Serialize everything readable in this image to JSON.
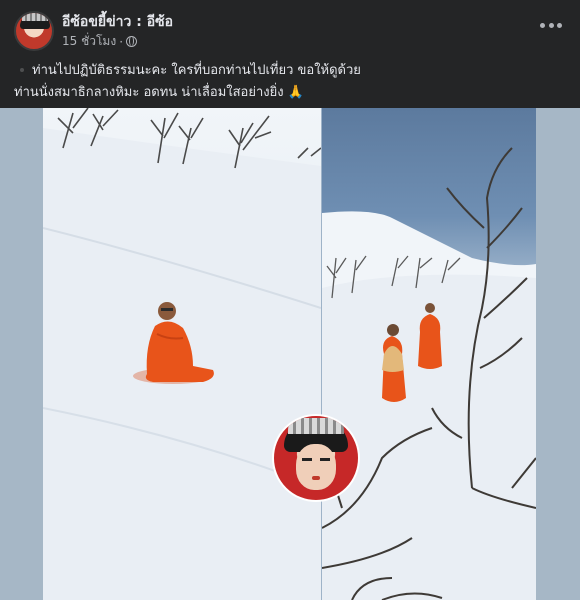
{
  "post": {
    "page_name": "อีซ้อขยี้ข่าว : อีซ้อ",
    "timestamp": "15 ชั่วโมง",
    "visibility_icon": "globe-icon",
    "more_icon": "more-options-icon",
    "caption_line1": "ท่านไปปฏิบัติธรรมนะคะ ใครที่บอกท่านไปเที่ยว ขอให้ดูด้วย",
    "caption_line2": "ท่านนั่งสมาธิกลางหิมะ อดทน น่าเลื่อมใสอย่างยิ่ง",
    "caption_emoji": "🙏"
  },
  "colors": {
    "background": "#242526",
    "primary_text": "#e4e6eb",
    "secondary_text": "#b0b3b8",
    "robe": "#e8541a"
  }
}
